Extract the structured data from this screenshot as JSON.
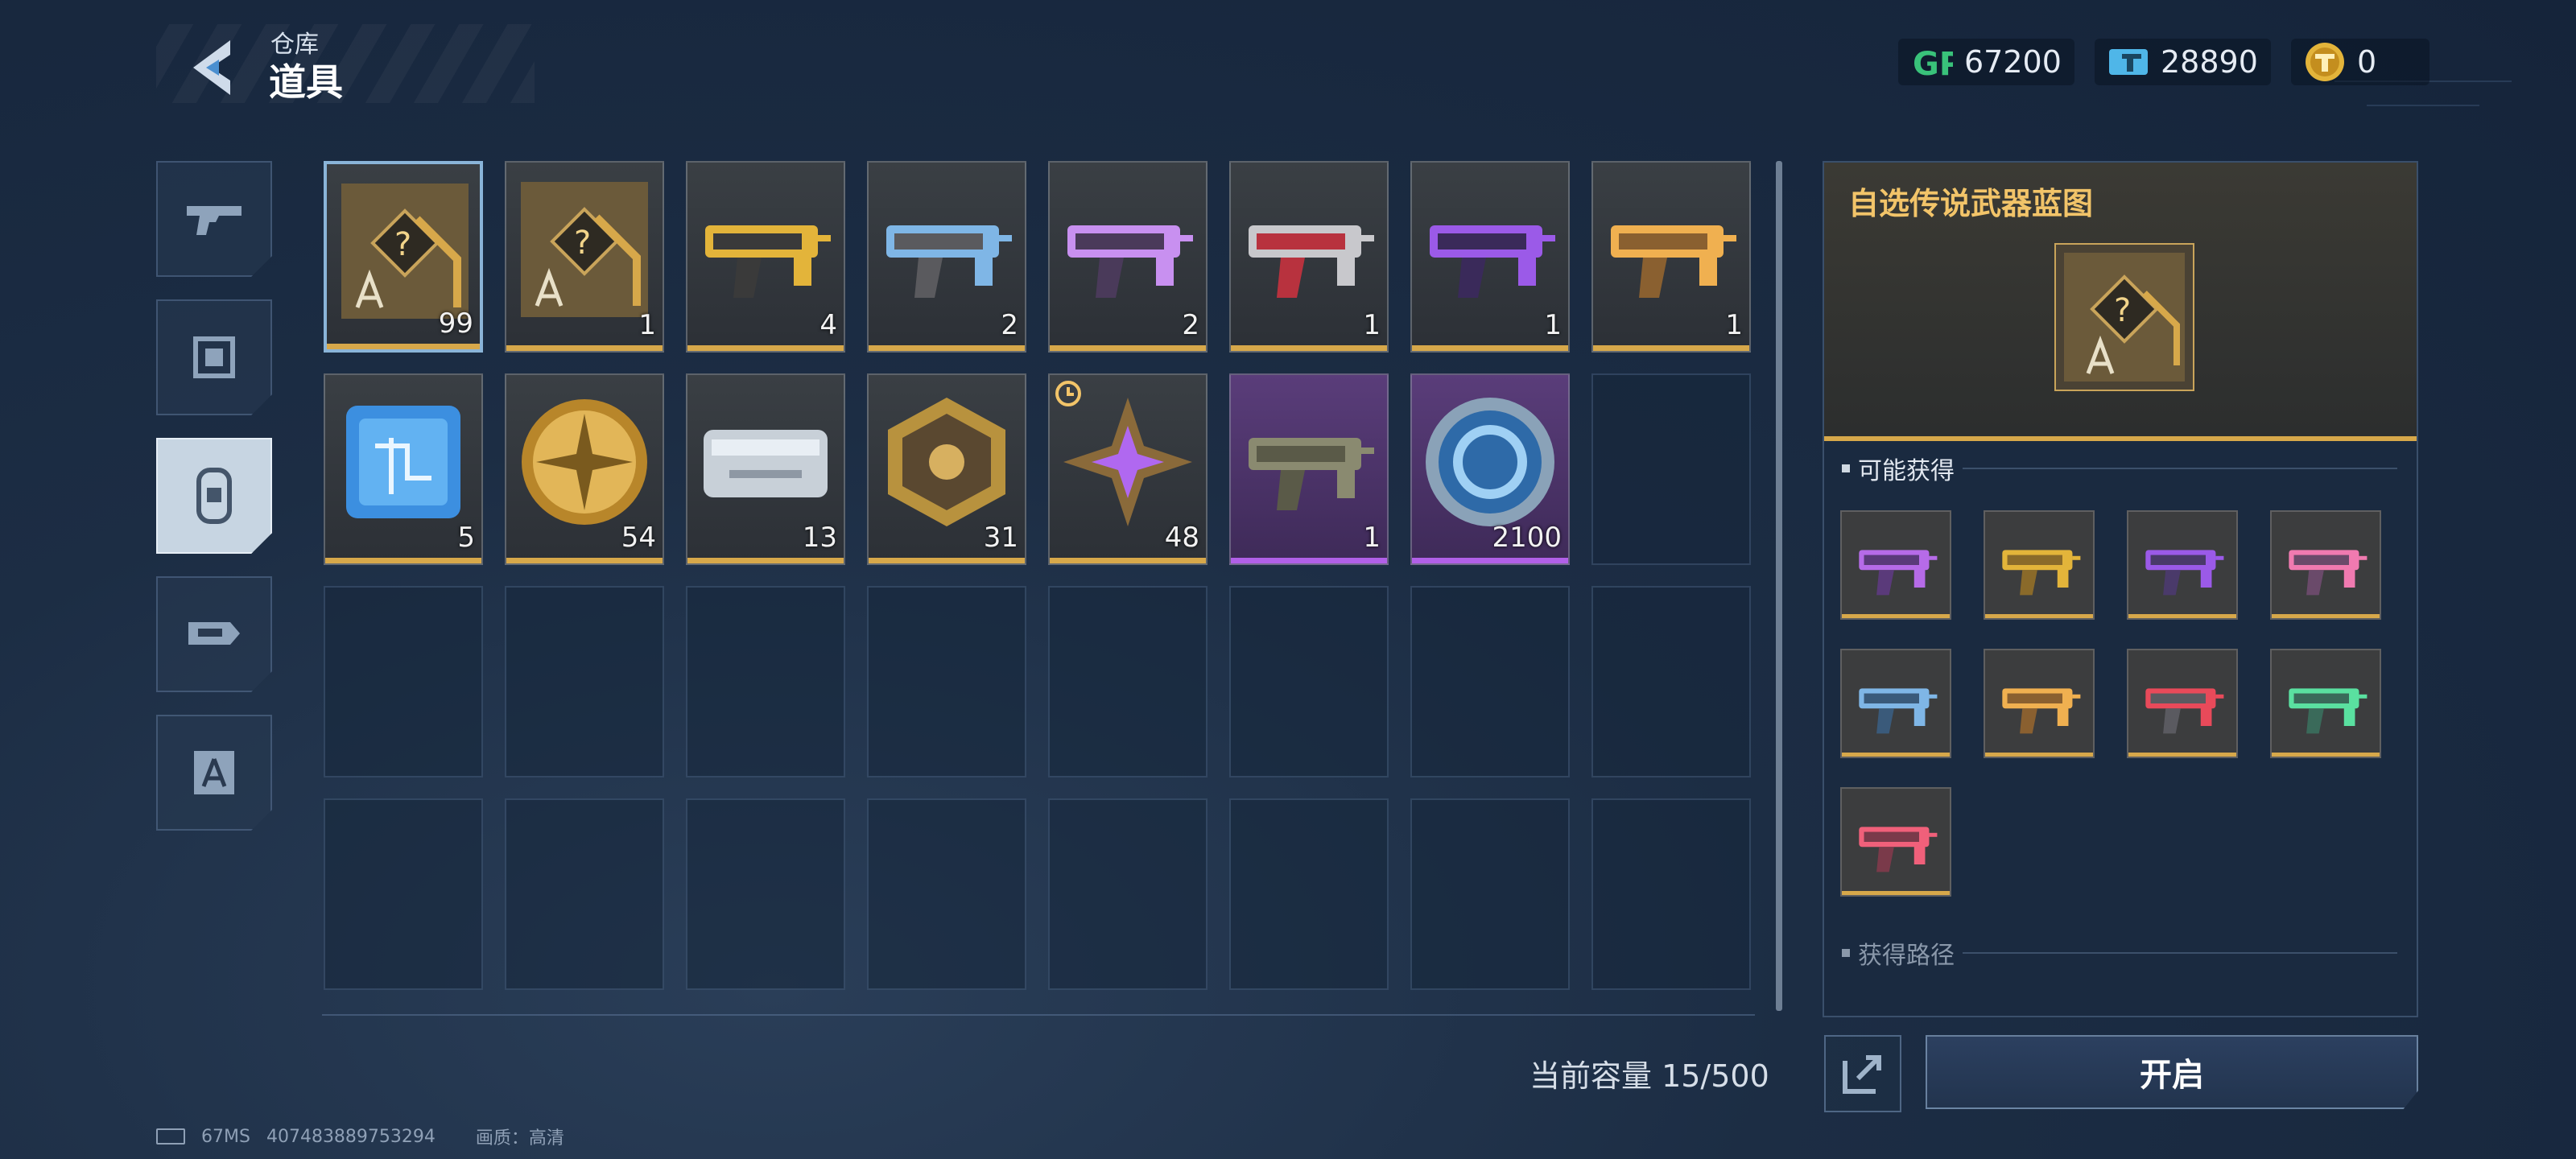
{
  "header": {
    "breadcrumb": "仓库",
    "title": "道具"
  },
  "currencies": [
    {
      "icon": "gp-icon",
      "value": "67200"
    },
    {
      "icon": "ticket-icon",
      "value": "28890"
    },
    {
      "icon": "coin-icon",
      "value": "0"
    }
  ],
  "side_tabs": [
    "weapon-tab-icon",
    "frame-tab-icon",
    "item-tab-icon",
    "gift-tab-icon",
    "blueprint-tab-icon"
  ],
  "inventory": {
    "items": [
      {
        "count": "99",
        "kind": "blueprint-box",
        "rarity": "gold"
      },
      {
        "count": "1",
        "kind": "blueprint-box",
        "rarity": "gold"
      },
      {
        "count": "4",
        "kind": "rifle-gold",
        "rarity": "gold"
      },
      {
        "count": "2",
        "kind": "pistol-blue",
        "rarity": "gold"
      },
      {
        "count": "2",
        "kind": "rifle-purple",
        "rarity": "gold"
      },
      {
        "count": "1",
        "kind": "rifle-red",
        "rarity": "gold"
      },
      {
        "count": "1",
        "kind": "rifle-violet",
        "rarity": "gold"
      },
      {
        "count": "1",
        "kind": "rifle-goldorange",
        "rarity": "gold"
      },
      {
        "count": "5",
        "kind": "chip",
        "rarity": "gold"
      },
      {
        "count": "54",
        "kind": "gold-coin",
        "rarity": "gold"
      },
      {
        "count": "13",
        "kind": "case",
        "rarity": "gold"
      },
      {
        "count": "31",
        "kind": "hex-badge",
        "rarity": "gold"
      },
      {
        "count": "48",
        "kind": "purple-star",
        "rarity": "gold"
      },
      {
        "count": "1",
        "kind": "smg-purple",
        "rarity": "purple"
      },
      {
        "count": "2100",
        "kind": "blue-token",
        "rarity": "purple"
      }
    ]
  },
  "capacity": "当前容量 15/500",
  "detail": {
    "title": "自选传说武器蓝图",
    "possible_label": "可能获得",
    "source_label": "获得路径",
    "rewards": [
      "purple",
      "gold",
      "violet",
      "pink",
      "blue",
      "goldorange",
      "red",
      "green",
      "pinkred"
    ]
  },
  "actions": {
    "open_label": "开启"
  },
  "footer": {
    "ping": "67MS",
    "uid": "407483889753294",
    "quality": "画质：高清"
  }
}
